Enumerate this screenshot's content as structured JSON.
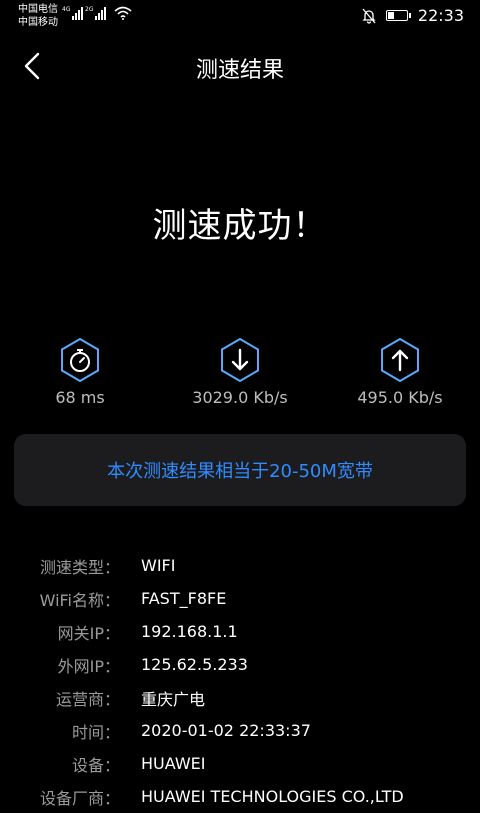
{
  "status": {
    "carrier1": "中国电信",
    "carrier2": "中国移动",
    "net1": "4G",
    "net2": "2G",
    "time": "22:33",
    "battery_level": 0.35
  },
  "header": {
    "title": "测速结果"
  },
  "result": {
    "message": "测速成功！"
  },
  "metrics": [
    {
      "icon": "stopwatch-icon",
      "value": "68 ms"
    },
    {
      "icon": "download-arrow-icon",
      "value": "3029.0 Kb/s"
    },
    {
      "icon": "upload-arrow-icon",
      "value": "495.0 Kb/s"
    }
  ],
  "banner": {
    "text": "本次测速结果相当于20-50M宽带"
  },
  "info": [
    {
      "label": "测速类型：",
      "value": "WIFI"
    },
    {
      "label": "WiFi名称：",
      "value": "FAST_F8FE"
    },
    {
      "label": "网关IP：",
      "value": "192.168.1.1"
    },
    {
      "label": "外网IP：",
      "value": "125.62.5.233"
    },
    {
      "label": "运营商：",
      "value": "重庆广电"
    },
    {
      "label": "时间：",
      "value": "2020-01-02 22:33:37"
    },
    {
      "label": "设备：",
      "value": "HUAWEI"
    },
    {
      "label": "设备厂商：",
      "value": "HUAWEI TECHNOLOGIES CO.,LTD"
    }
  ],
  "colors": {
    "accent": "#2f8bff",
    "icon": "#5aa9ff",
    "background": "#000000",
    "card": "#1c1c1e"
  }
}
